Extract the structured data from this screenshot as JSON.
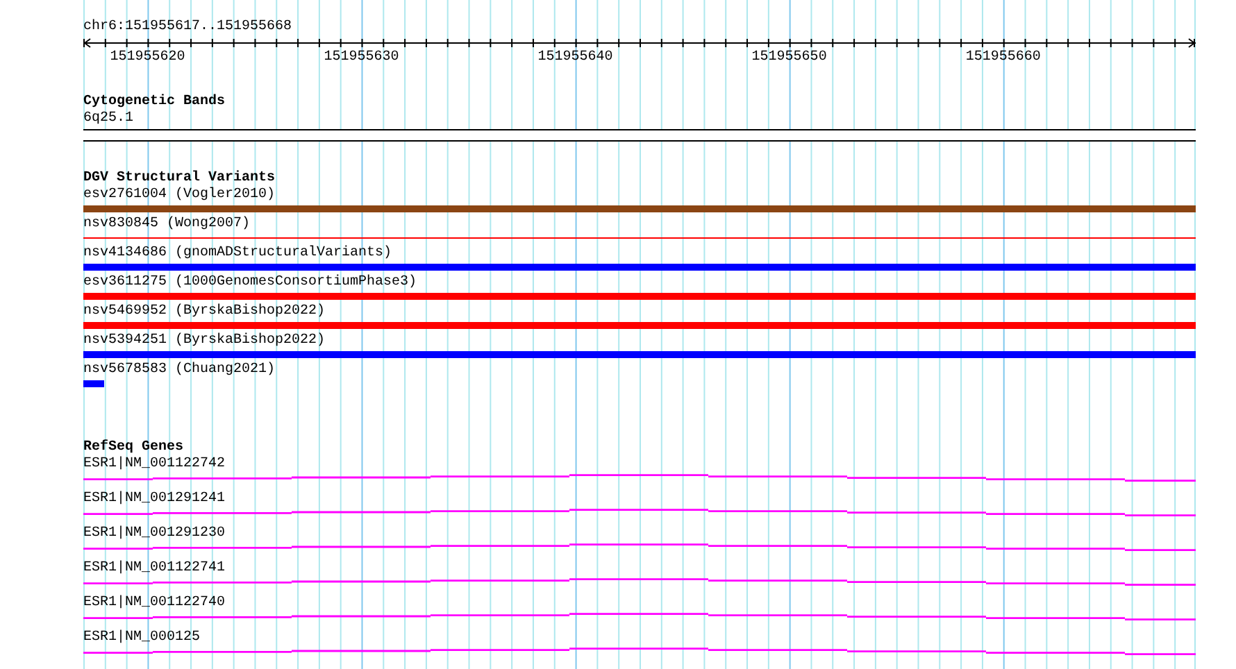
{
  "location": "chr6:151955617..151955668",
  "ruler": {
    "labels": [
      "151955620",
      "151955630",
      "151955640",
      "151955650",
      "151955660"
    ]
  },
  "tracks": [
    {
      "kind": "cytoband",
      "title": "Cytogenetic Bands",
      "features": [
        {
          "label": "6q25.1"
        }
      ]
    },
    {
      "kind": "variants",
      "title": "DGV Structural Variants",
      "features": [
        {
          "label": "esv2761004 (Vogler2010)",
          "kind": "bar",
          "color": "#8b4513"
        },
        {
          "label": "nsv830845 (Wong2007)",
          "kind": "line",
          "color": "#ff0000"
        },
        {
          "label": "nsv4134686 (gnomADStructuralVariants)",
          "kind": "bar",
          "color": "#0000ff"
        },
        {
          "label": "esv3611275 (1000GenomesConsortiumPhase3)",
          "kind": "bar",
          "color": "#ff0000"
        },
        {
          "label": "nsv5469952 (ByrskaBishop2022)",
          "kind": "bar",
          "color": "#ff0000"
        },
        {
          "label": "nsv5394251 (ByrskaBishop2022)",
          "kind": "bar",
          "color": "#0000ff"
        },
        {
          "label": "nsv5678583 (Chuang2021)",
          "kind": "end",
          "color": "#0000ff"
        }
      ]
    },
    {
      "kind": "genes",
      "title": "RefSeq Genes",
      "features": [
        {
          "label": "ESR1|NM_001122742"
        },
        {
          "label": "ESR1|NM_001291241"
        },
        {
          "label": "ESR1|NM_001291230"
        },
        {
          "label": "ESR1|NM_001122741"
        },
        {
          "label": "ESR1|NM_001122740"
        },
        {
          "label": "ESR1|NM_000125"
        }
      ]
    }
  ]
}
